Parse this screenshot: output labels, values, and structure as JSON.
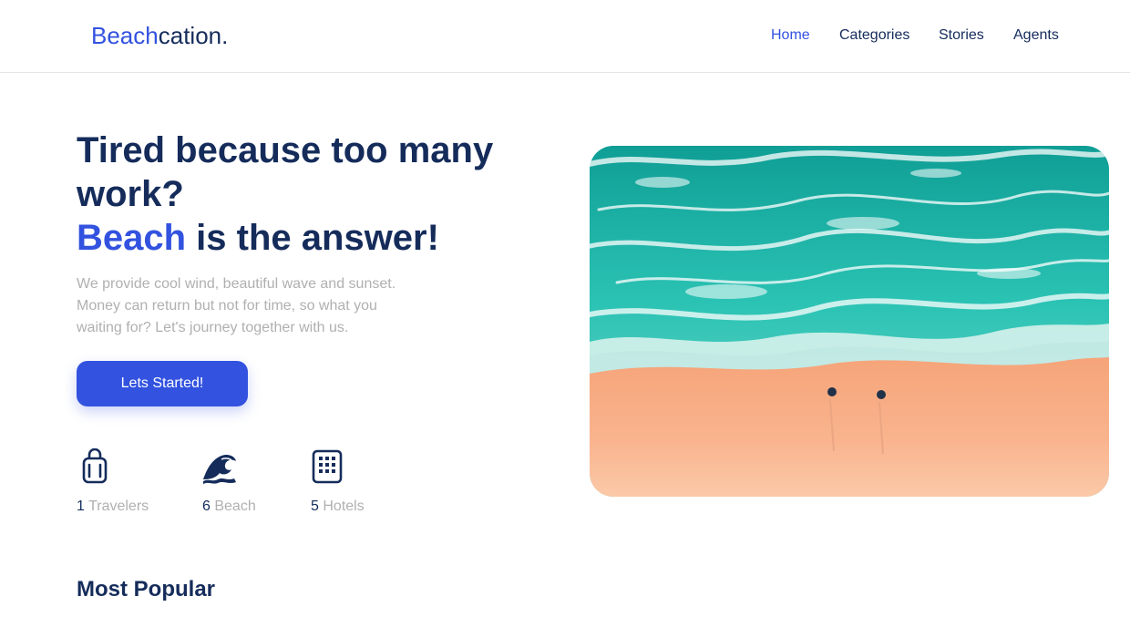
{
  "header": {
    "brand_part1": "Beach",
    "brand_part2": "cation.",
    "nav": [
      {
        "label": "Home",
        "active": true
      },
      {
        "label": "Categories",
        "active": false
      },
      {
        "label": "Stories",
        "active": false
      },
      {
        "label": "Agents",
        "active": false
      }
    ]
  },
  "hero": {
    "title_line1": "Tired because too many work?",
    "title_accent": "Beach",
    "title_rest": " is the answer!",
    "description": "We provide cool wind, beautiful wave and sunset. Money can return but not for time, so what you waiting for? Let's journey together with us.",
    "cta_label": "Lets Started!",
    "image_icon": "aerial-beach-photo"
  },
  "stats": [
    {
      "icon": "luggage-icon",
      "count": "1",
      "label": "Travelers"
    },
    {
      "icon": "wave-icon",
      "count": "6",
      "label": "Beach"
    },
    {
      "icon": "building-icon",
      "count": "5",
      "label": "Hotels"
    }
  ],
  "sections": {
    "most_popular": "Most Popular"
  },
  "colors": {
    "primary": "#3252df",
    "navy": "#152c5b",
    "muted": "#b0b0b0"
  }
}
